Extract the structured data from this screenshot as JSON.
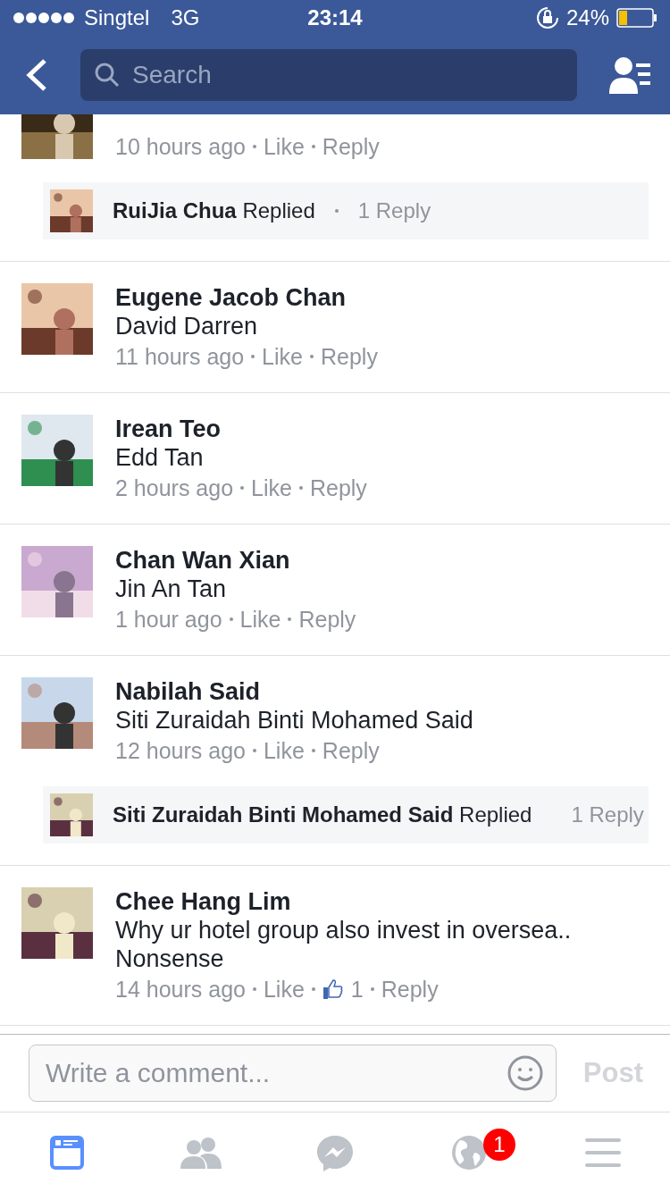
{
  "status_bar": {
    "carrier": "Singtel",
    "network": "3G",
    "time": "23:14",
    "battery": "24%"
  },
  "nav": {
    "search_placeholder": "Search"
  },
  "comments": [
    {
      "meta": {
        "time": "10 hours ago",
        "like": "Like",
        "reply": "Reply"
      },
      "replies": {
        "name": "RuiJia Chua",
        "verb": "Replied",
        "count": "1 Reply"
      }
    },
    {
      "name": "Eugene Jacob Chan",
      "text": "David Darren",
      "meta": {
        "time": "11 hours ago",
        "like": "Like",
        "reply": "Reply"
      }
    },
    {
      "name": "Irean Teo",
      "text": "Edd Tan",
      "meta": {
        "time": "2 hours ago",
        "like": "Like",
        "reply": "Reply"
      }
    },
    {
      "name": "Chan Wan Xian",
      "text": "Jin An Tan",
      "meta": {
        "time": "1 hour ago",
        "like": "Like",
        "reply": "Reply"
      }
    },
    {
      "name": "Nabilah Said",
      "text": "Siti Zuraidah Binti Mohamed Said",
      "meta": {
        "time": "12 hours ago",
        "like": "Like",
        "reply": "Reply"
      },
      "replies": {
        "name": "Siti Zuraidah Binti Mohamed Said",
        "verb": "Replied",
        "count": "1 Reply"
      }
    },
    {
      "name": "Chee Hang Lim",
      "text": "Why ur hotel group also invest in oversea.. Nonsense",
      "meta": {
        "time": "14 hours ago",
        "like": "Like",
        "likes": "1",
        "reply": "Reply"
      }
    }
  ],
  "composer": {
    "placeholder": "Write a comment...",
    "post": "Post"
  },
  "tabs": [
    {
      "kind": "feed",
      "selected": true
    },
    {
      "kind": "friends",
      "selected": false
    },
    {
      "kind": "messenger",
      "selected": false
    },
    {
      "kind": "globe",
      "selected": false,
      "badge": "1"
    },
    {
      "kind": "menu",
      "selected": false
    }
  ]
}
